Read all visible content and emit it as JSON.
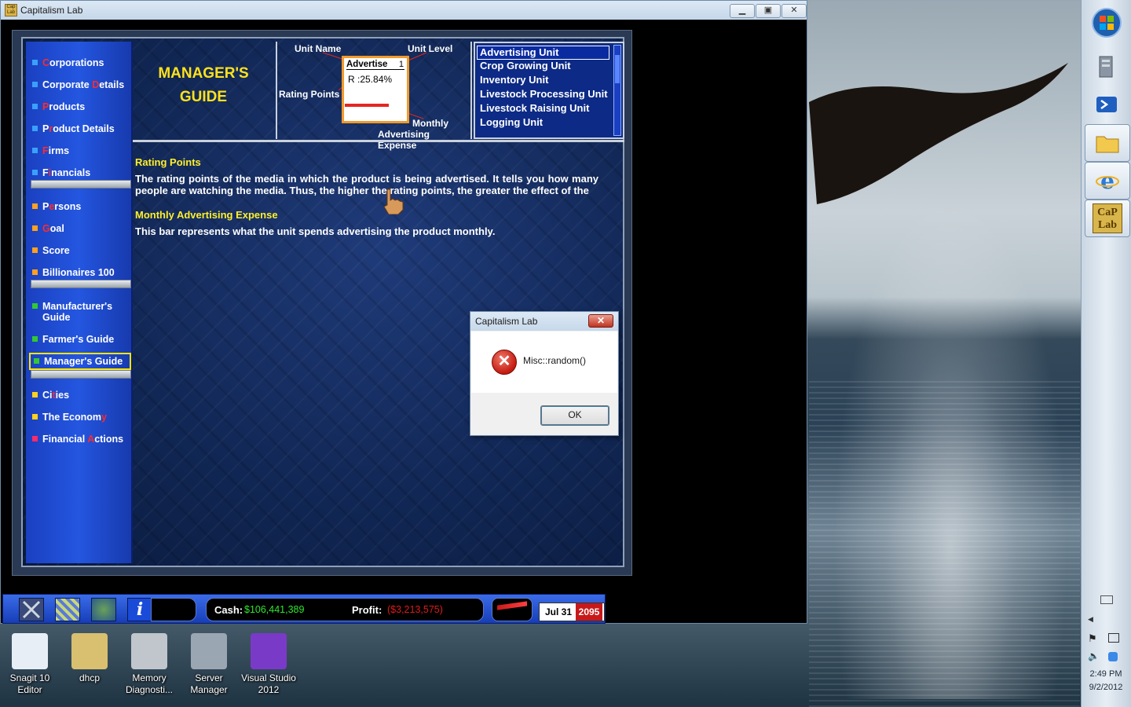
{
  "window": {
    "title": "Capitalism Lab",
    "app_icon_text": "Cap Lab"
  },
  "nav": {
    "items": [
      {
        "pre": "",
        "hl": "C",
        "post": "orporations",
        "color": "#3aa0ff"
      },
      {
        "pre": "Corporate ",
        "hl": "D",
        "post": "etails",
        "color": "#3aa0ff"
      },
      {
        "pre": "",
        "hl": "P",
        "post": "roducts",
        "color": "#3aa0ff"
      },
      {
        "pre": "P",
        "hl": "r",
        "post": "oduct Details",
        "color": "#3aa0ff"
      },
      {
        "pre": "",
        "hl": "F",
        "post": "irms",
        "color": "#3aa0ff"
      },
      {
        "pre": "F",
        "hl": "i",
        "post": "nancials",
        "color": "#3aa0ff"
      },
      {
        "pre": "P",
        "hl": "e",
        "post": "rsons",
        "color": "#ffa020"
      },
      {
        "pre": "",
        "hl": "G",
        "post": "oal",
        "color": "#ffa020"
      },
      {
        "pre": "Score",
        "hl": "",
        "post": "",
        "color": "#ffa020"
      },
      {
        "pre": "Billionaires 100",
        "hl": "",
        "post": "",
        "color": "#ffa020"
      },
      {
        "pre": "Manufacturer's Guide",
        "hl": "",
        "post": "",
        "color": "#32c832"
      },
      {
        "pre": "Farmer's Guide",
        "hl": "",
        "post": "",
        "color": "#32c832"
      },
      {
        "pre": "Manager's Guide",
        "hl": "",
        "post": "",
        "color": "#32c832"
      },
      {
        "pre": "Ci",
        "hl": "t",
        "post": "ies",
        "color": "#ffd21a"
      },
      {
        "pre": "The Econom",
        "hl": "y",
        "post": "",
        "color": "#ffd21a"
      },
      {
        "pre": "Financial ",
        "hl": "A",
        "post": "ctions",
        "color": "#ff2a6a"
      }
    ]
  },
  "guide": {
    "title_line1": "MANAGER'S",
    "title_line2": "GUIDE"
  },
  "diagram": {
    "unit_name_label": "Unit Name",
    "unit_level_label": "Unit Level",
    "rating_points_label": "Rating Points",
    "monthly_label_1": "Monthly",
    "monthly_label_2": "Advertising Expense",
    "mini_name": "Advertise",
    "mini_level": "1",
    "mini_rating": "R :25.84%",
    "mini_bar_fraction": 0.7
  },
  "unit_list": {
    "items": [
      "Advertising Unit",
      "Crop Growing Unit",
      "Inventory Unit",
      "Livestock Processing Unit",
      "Livestock Raising Unit",
      "Logging Unit"
    ],
    "selected_index": 0
  },
  "content": {
    "h1": "Rating Points",
    "p1": "The rating points of the media in which the product is being advertised. It tells you how many people are watching the media. Thus, the higher the rating points, the greater the effect of the",
    "h2": "Monthly Advertising Expense",
    "p2": "This bar represents what the unit spends advertising the product monthly."
  },
  "dialog": {
    "title": "Capitalism Lab",
    "close": "✕",
    "message": "Misc::random()",
    "ok": "OK",
    "icon": "error-x-icon"
  },
  "toolbar": {
    "cash_label": "Cash:",
    "cash_value": "$106,441,389",
    "cash_color": "#2ee82e",
    "profit_label": "Profit:",
    "profit_value": "($3,213,575)",
    "profit_color": "#e01a1a",
    "date": "Jul  31",
    "year": "2095",
    "info_icon_text": "i"
  },
  "desktop_icons": [
    {
      "label": "Snagit 10 Editor",
      "icon": "snagit-icon"
    },
    {
      "label": "dhcp",
      "icon": "dhcp-icon"
    },
    {
      "label": "Memory Diagnosti...",
      "icon": "memory-diagnostics-icon"
    },
    {
      "label": "Server Manager",
      "icon": "server-manager-icon"
    },
    {
      "label": "Visual Studio 2012",
      "icon": "visual-studio-icon"
    }
  ],
  "taskbar": {
    "time": "2:49 PM",
    "date": "9/2/2012",
    "caplab_text": "CaP Lab"
  }
}
